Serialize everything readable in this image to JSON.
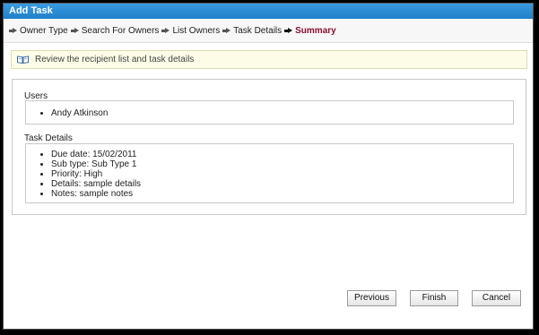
{
  "window": {
    "title": "Add Task"
  },
  "wizard": {
    "steps": [
      {
        "label": "Owner Type"
      },
      {
        "label": "Search For Owners"
      },
      {
        "label": "List Owners"
      },
      {
        "label": "Task Details"
      },
      {
        "label": "Summary",
        "active": true
      }
    ]
  },
  "banner": {
    "text": "Review the recipient list and task details",
    "icon": "book-icon"
  },
  "users": {
    "label": "Users",
    "items": [
      "Andy Atkinson"
    ]
  },
  "task_details": {
    "label": "Task Details",
    "items": [
      "Due date: 15/02/2011",
      "Sub type: Sub Type 1",
      "Priority: High",
      "Details: sample details",
      "Notes: sample notes"
    ]
  },
  "buttons": {
    "previous": "Previous",
    "finish": "Finish",
    "cancel": "Cancel"
  },
  "colors": {
    "titlebar": "#1f7fc8",
    "active_step": "#8a1030",
    "banner_bg": "#fdfde7"
  }
}
